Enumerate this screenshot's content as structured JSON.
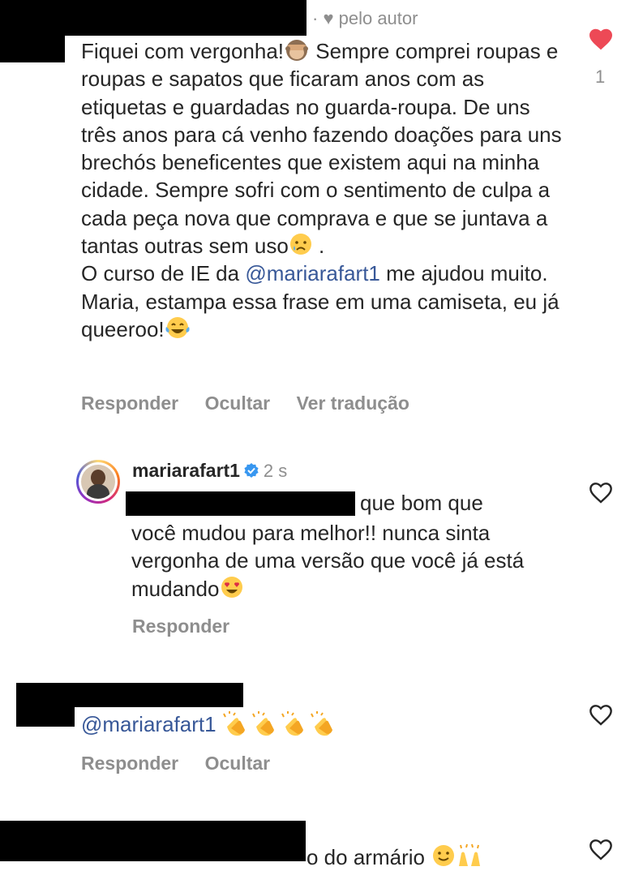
{
  "comment1": {
    "author_label": "· ♥ pelo autor",
    "text_parts": [
      "Fiquei com vergonha!",
      " Sempre comprei roupas e roupas e sapatos que ficaram anos com as etiquetas e guardadas no guarda-roupa. De uns três anos para cá venho fazendo doações para uns brechós beneficentes que existem aqui na minha cidade. Sempre sofri com o sentimento de culpa a cada peça nova que comprava e que se juntava a tantas outras sem uso",
      " .",
      "O curso de IE da ",
      "@mariarafart1",
      " me ajudou muito. Maria, estampa essa frase em uma camiseta, eu já queeroo!"
    ],
    "like_count": "1",
    "actions": {
      "reply": "Responder",
      "hide": "Ocultar",
      "translate": "Ver tradução"
    }
  },
  "reply1": {
    "username": "mariarafart1",
    "time": "2 s",
    "text_first": "que bom que",
    "text_rest": "você mudou para melhor!! nunca sinta vergonha de uma versão que você já está mudando",
    "actions": {
      "reply": "Responder"
    }
  },
  "comment2": {
    "mention": "@mariarafart1",
    "actions": {
      "reply": "Responder",
      "hide": "Ocultar"
    }
  },
  "comment3": {
    "partial_text": "o do armário"
  },
  "colors": {
    "like_red": "#ed4956",
    "link_blue": "#385898",
    "verified_blue": "#3897f0",
    "muted_gray": "#8e8e8e"
  },
  "icons": [
    "heart-filled-icon",
    "heart-outline-icon",
    "verified-badge-icon",
    "see-no-evil-monkey-emoji",
    "crying-face-emoji",
    "tears-of-joy-emoji",
    "heart-eyes-emoji",
    "clapping-hands-emoji",
    "smiling-face-emoji",
    "raising-hands-emoji"
  ]
}
